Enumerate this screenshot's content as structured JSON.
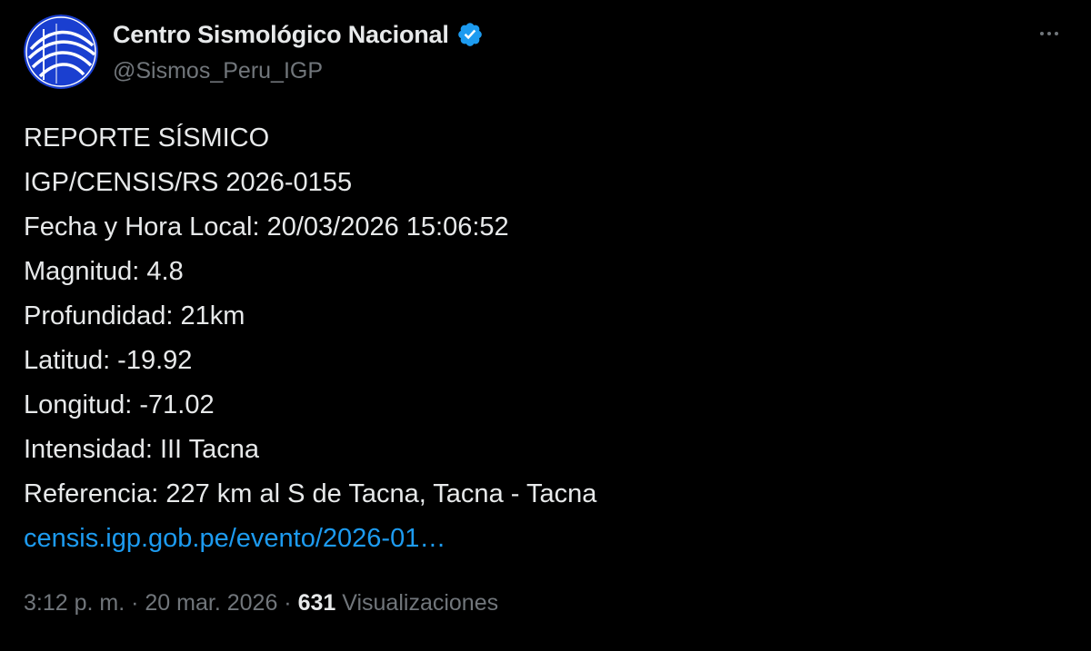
{
  "author": {
    "display_name": "Centro Sismológico Nacional",
    "handle": "@Sismos_Peru_IGP",
    "verified": true,
    "avatar_icon": "igp-logo-icon",
    "avatar_color": "#1a3fd0"
  },
  "body": {
    "lines": [
      "REPORTE SÍSMICO",
      "IGP/CENSIS/RS 2026-0155",
      "Fecha y Hora Local: 20/03/2026 15:06:52",
      "Magnitud: 4.8",
      "Profundidad: 21km",
      "Latitud: -19.92",
      "Longitud: -71.02",
      "Intensidad: III Tacna",
      "Referencia: 227 km al S de Tacna, Tacna - Tacna"
    ],
    "link": "censis.igp.gob.pe/evento/2026-01…"
  },
  "meta": {
    "time": "3:12 p. m.",
    "separator": "·",
    "date": "20 mar. 2026",
    "views_count": "631",
    "views_label": "Visualizaciones"
  },
  "colors": {
    "background": "#000000",
    "text": "#e7e9ea",
    "secondary": "#71767b",
    "link": "#1d9bf0",
    "verified": "#1d9bf0"
  }
}
